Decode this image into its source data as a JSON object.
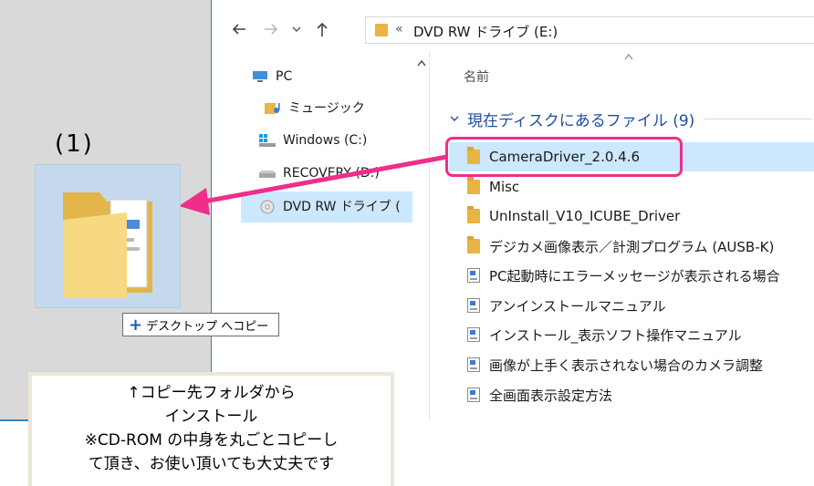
{
  "address_bar": {
    "back_icon": "arrow-left-icon",
    "forward_icon": "arrow-right-icon",
    "recent_icon": "chevron-down-icon",
    "up_icon": "arrow-up-icon",
    "overflow": "«",
    "path": "DVD RW ドライブ (E:)"
  },
  "nav_pane": {
    "items": [
      {
        "label": "PC",
        "icon": "pc-icon"
      },
      {
        "label": "ミュージック",
        "icon": "music-folder-icon"
      },
      {
        "label": "Windows (C:)",
        "icon": "windows-drive-icon"
      },
      {
        "label": "RECOVERY (D:)",
        "icon": "drive-icon"
      },
      {
        "label": "DVD RW ドライブ (",
        "icon": "dvd-drive-icon"
      }
    ],
    "selected_index": 4
  },
  "file_list": {
    "column_header": "名前",
    "group_label": "現在ディスクにあるファイル (9)",
    "files": [
      {
        "name": "CameraDriver_2.0.4.6",
        "type": "folder"
      },
      {
        "name": "Misc",
        "type": "folder"
      },
      {
        "name": "UnInstall_V10_ICUBE_Driver",
        "type": "folder"
      },
      {
        "name": "デジカメ画像表示／計測プログラム (AUSB-K)",
        "type": "folder"
      },
      {
        "name": "PC起動時にエラーメッセージが表示される場合",
        "type": "pdf"
      },
      {
        "name": "アンインストールマニュアル",
        "type": "pdf"
      },
      {
        "name": "インストール_表示ソフト操作マニュアル",
        "type": "pdf"
      },
      {
        "name": "画像が上手く表示されない場合のカメラ調整",
        "type": "pdf"
      },
      {
        "name": "全画面表示設定方法",
        "type": "pdf"
      }
    ],
    "selected_index": 0
  },
  "annotation": {
    "step_label": "(1)",
    "drag_tooltip": "+ デスクトップ へコピー",
    "note_lines": [
      "↑コピー先フォルダから",
      "インストール",
      "※CD-ROM の中身を丸ごとコピーし",
      "て頂き、お使い頂いても大丈夫です"
    ],
    "highlight_color": "#ee2e8a"
  }
}
